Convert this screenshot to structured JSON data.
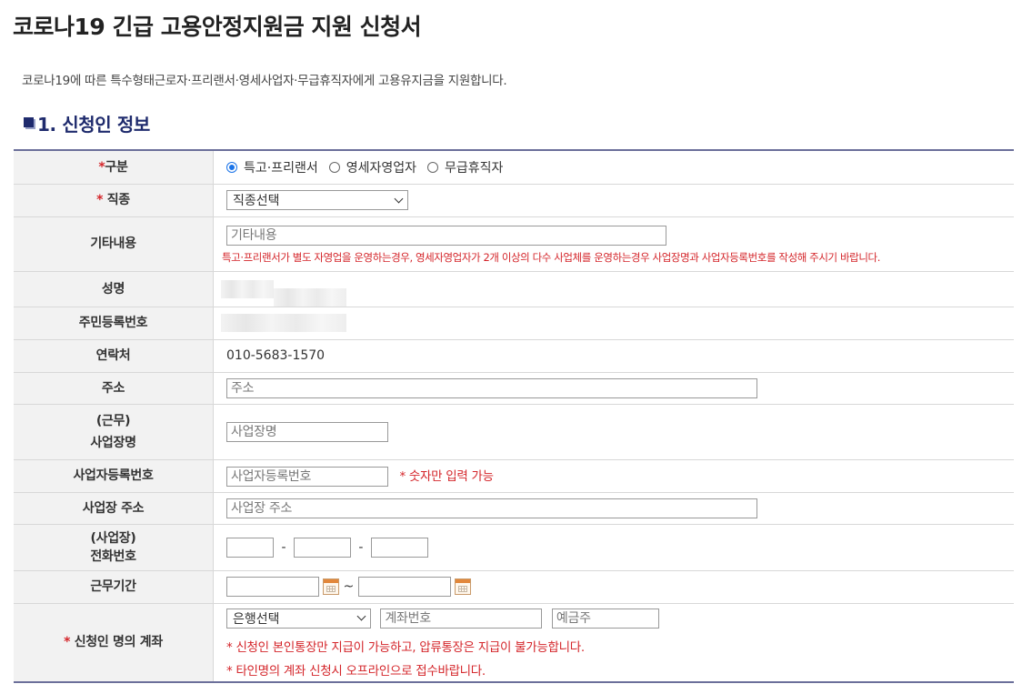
{
  "page": {
    "title": "코로나19 긴급 고용안정지원금 지원 신청서",
    "intro": "코로나19에 따른 특수형태근로자·프리랜서·영세사업자·무급휴직자에게 고용유지금을 지원합니다.",
    "section_title": "1. 신청인 정보"
  },
  "form": {
    "type": {
      "required_mark": "*",
      "label": "구분",
      "options": [
        "특고·프리랜서",
        "영세자영업자",
        "무급휴직자"
      ],
      "selected": "특고·프리랜서"
    },
    "job": {
      "required_mark": "*",
      "label": "직종",
      "select_value": "직종선택"
    },
    "etc": {
      "label": "기타내용",
      "placeholder": "기타내용",
      "note": "특고·프리랜서가 별도 자영업을 운영하는경우, 영세자영업자가 2개 이상의 다수 사업체를 운영하는경우 사업장명과 사업자등록번호를 작성해 주시기 바랍니다."
    },
    "name": {
      "label": "성명"
    },
    "resident_no": {
      "label": "주민등록번호"
    },
    "contact": {
      "label": "연락처",
      "value": "010-5683-1570"
    },
    "address": {
      "label": "주소",
      "placeholder": "주소"
    },
    "workplace": {
      "label_line1": "(근무)",
      "label_line2": "사업장명",
      "placeholder": "사업장명"
    },
    "biz_no": {
      "label": "사업자등록번호",
      "placeholder": "사업자등록번호",
      "note": "* 숫자만 입력 가능"
    },
    "biz_address": {
      "label": "사업장 주소",
      "placeholder": "사업장 주소"
    },
    "biz_phone": {
      "label_line1": "(사업장)",
      "label_line2": "전화번호",
      "separator": "-"
    },
    "period": {
      "label": "근무기간",
      "separator": "~"
    },
    "account": {
      "required_mark": "*",
      "label": "신청인 명의 계좌",
      "bank_select_value": "은행선택",
      "account_placeholder": "계좌번호",
      "holder_placeholder": "예금주",
      "note1": "* 신청인 본인통장만 지급이 가능하고, 압류통장은 지급이 불가능합니다.",
      "note2": "* 타인명의 계좌 신청시 오프라인으로 접수바랍니다."
    }
  },
  "colors": {
    "section_blue": "#1f2b6d",
    "required_red": "#d4252a",
    "radio_selected": "#1a73e8",
    "header_bg": "#f2f2f2"
  },
  "icons": [
    "calendar-icon",
    "chevron-down-icon",
    "section-bullet-icon"
  ]
}
